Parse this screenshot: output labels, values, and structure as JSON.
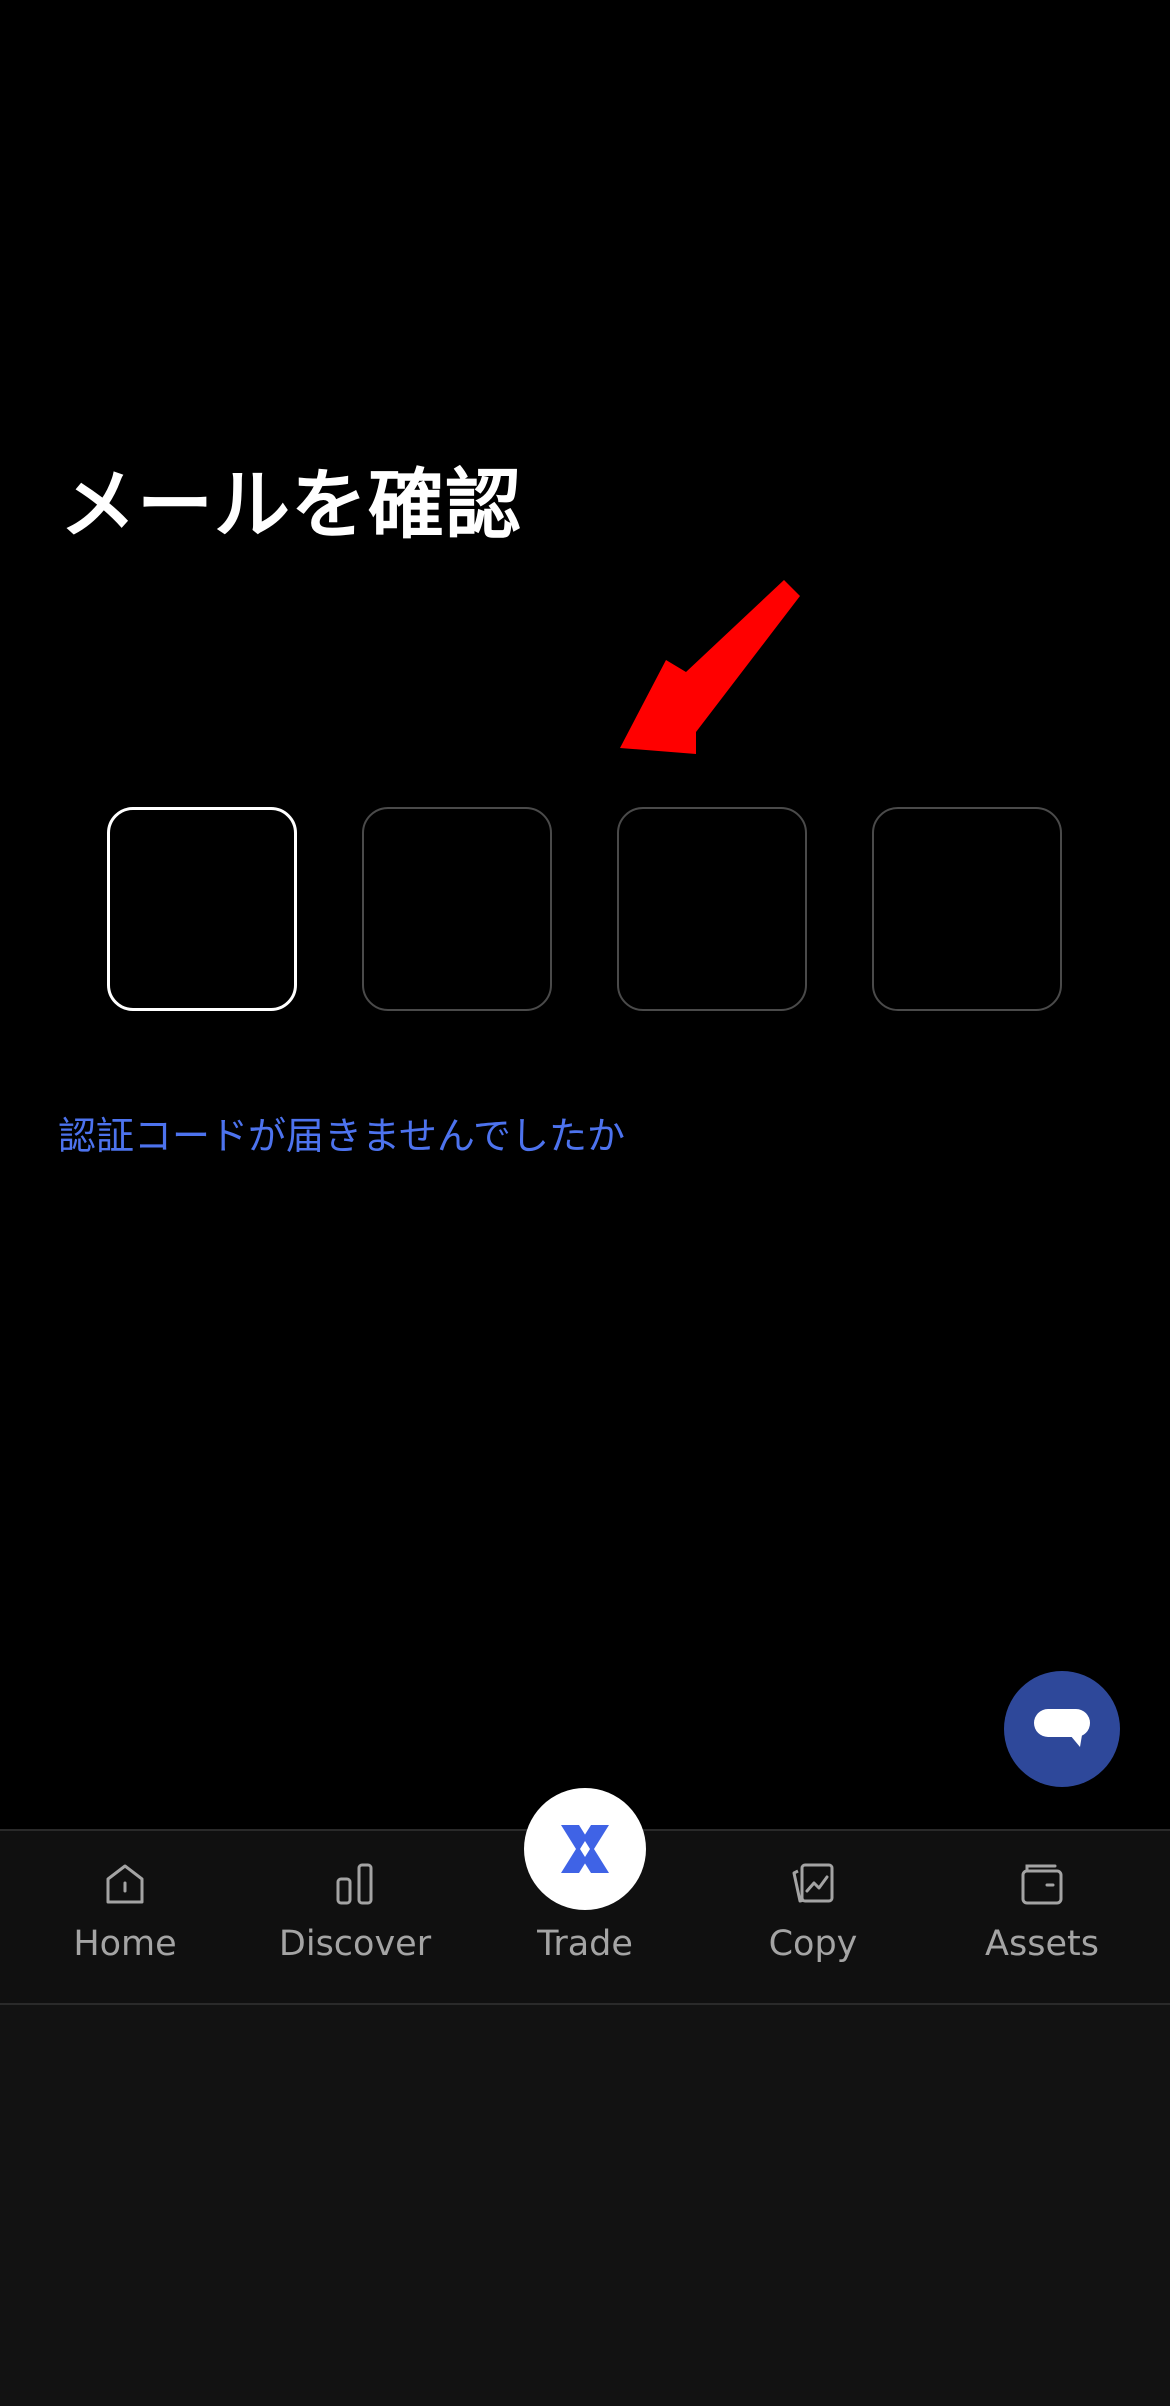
{
  "page": {
    "title": "メールを確認",
    "resend_link": "認証コードが届きませんでしたか"
  },
  "code_input": {
    "digits": [
      "",
      "",
      "",
      ""
    ],
    "active_index": 0
  },
  "colors": {
    "background": "#000000",
    "link": "#4d73ee",
    "annotation_arrow": "#ff0000",
    "chat_button": "#2e489a",
    "brand_blue": "#3f63e6",
    "nav_label": "#a4a4a4"
  },
  "chat_button": {
    "icon": "chat-bubble-icon"
  },
  "nav": {
    "items": [
      {
        "label": "Home",
        "icon": "home-icon"
      },
      {
        "label": "Discover",
        "icon": "bar-chart-icon"
      },
      {
        "label": "Trade",
        "icon": "trade-x-icon"
      },
      {
        "label": "Copy",
        "icon": "copy-trade-icon"
      },
      {
        "label": "Assets",
        "icon": "wallet-icon"
      }
    ]
  }
}
